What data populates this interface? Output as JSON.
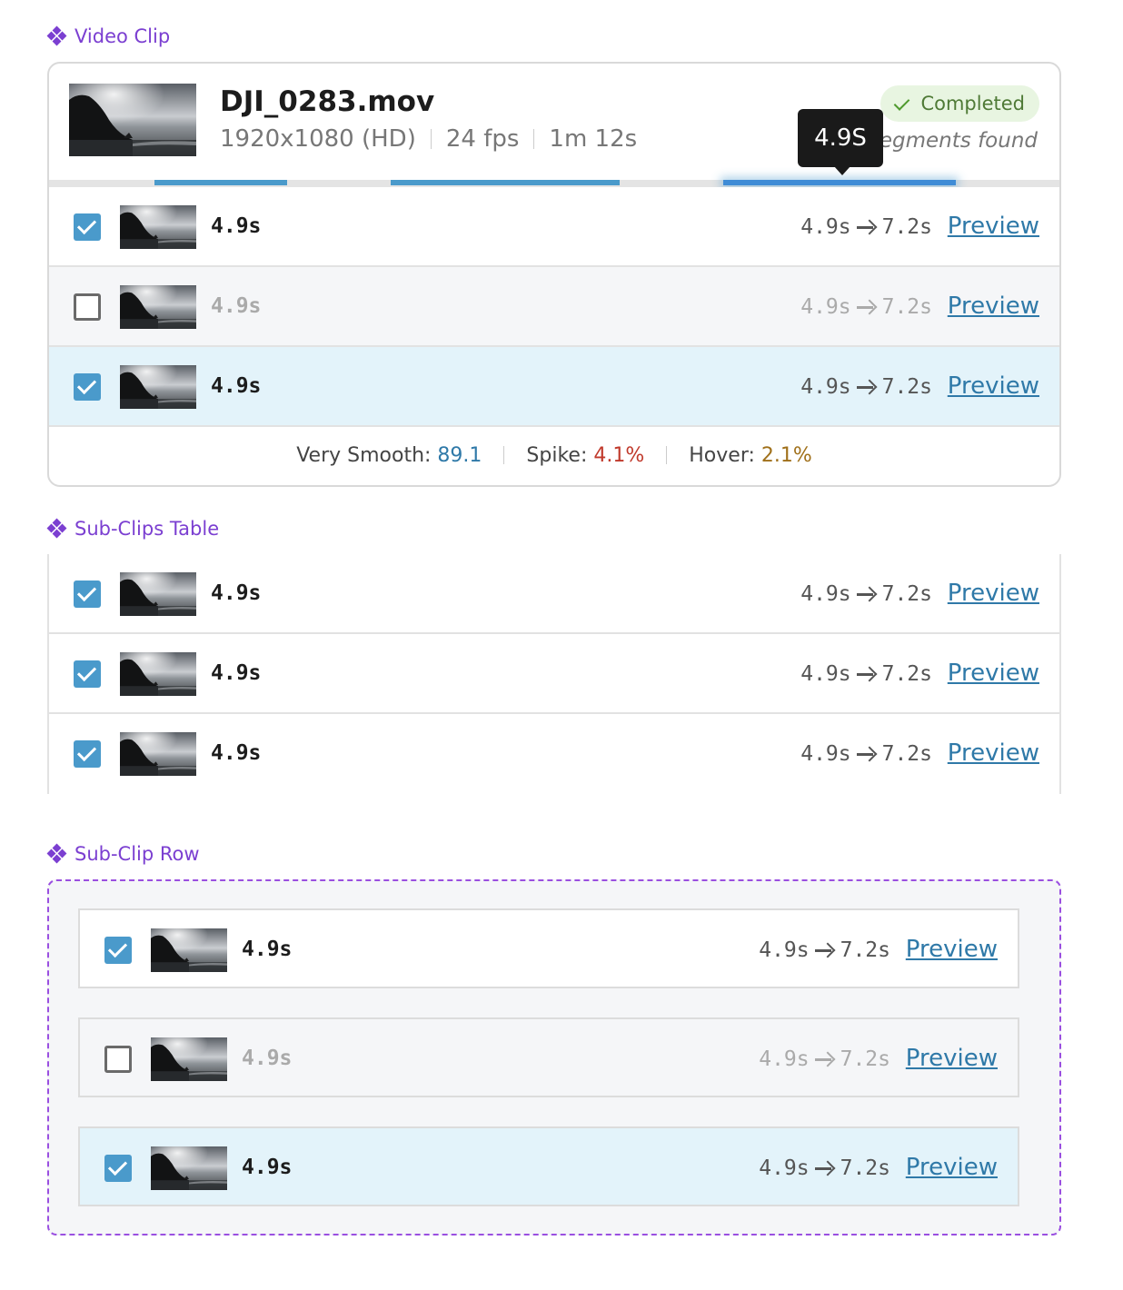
{
  "sections": {
    "video_clip": "Video Clip",
    "sub_clips_table": "Sub-Clips Table",
    "sub_clip_row": "Sub-Clip Row"
  },
  "clip": {
    "filename": "DJI_0283.mov",
    "resolution": "1920x1080 (HD)",
    "fps": "24 fps",
    "duration": "1m 12s",
    "status": "Completed",
    "segments_found": "segments found",
    "tooltip": "4.9S",
    "stats": {
      "smooth_label": "Very Smooth:",
      "smooth_value": "89.1",
      "spike_label": "Spike:",
      "spike_value": "4.1%",
      "hover_label": "Hover:",
      "hover_value": "2.1%"
    }
  },
  "colors": {
    "accent": "#4a9acb",
    "section_label": "#7b3fd1",
    "selected_row": "#e3f3fa",
    "muted_row": "#f5f6f8",
    "status_bg": "#e8f5e1"
  },
  "rows": {
    "clip": [
      {
        "checked": true,
        "duration": "4.9s",
        "start": "4.9s",
        "end": "7.2s",
        "preview": "Preview",
        "state": "default"
      },
      {
        "checked": false,
        "duration": "4.9s",
        "start": "4.9s",
        "end": "7.2s",
        "preview": "Preview",
        "state": "muted"
      },
      {
        "checked": true,
        "duration": "4.9s",
        "start": "4.9s",
        "end": "7.2s",
        "preview": "Preview",
        "state": "selected"
      }
    ],
    "table": [
      {
        "checked": true,
        "duration": "4.9s",
        "start": "4.9s",
        "end": "7.2s",
        "preview": "Preview",
        "state": "default"
      },
      {
        "checked": true,
        "duration": "4.9s",
        "start": "4.9s",
        "end": "7.2s",
        "preview": "Preview",
        "state": "default"
      },
      {
        "checked": true,
        "duration": "4.9s",
        "start": "4.9s",
        "end": "7.2s",
        "preview": "Preview",
        "state": "default"
      }
    ],
    "showcase": [
      {
        "checked": true,
        "duration": "4.9s",
        "start": "4.9s",
        "end": "7.2s",
        "preview": "Preview",
        "state": "default"
      },
      {
        "checked": false,
        "duration": "4.9s",
        "start": "4.9s",
        "end": "7.2s",
        "preview": "Preview",
        "state": "muted"
      },
      {
        "checked": true,
        "duration": "4.9s",
        "start": "4.9s",
        "end": "7.2s",
        "preview": "Preview",
        "state": "selected"
      }
    ]
  }
}
